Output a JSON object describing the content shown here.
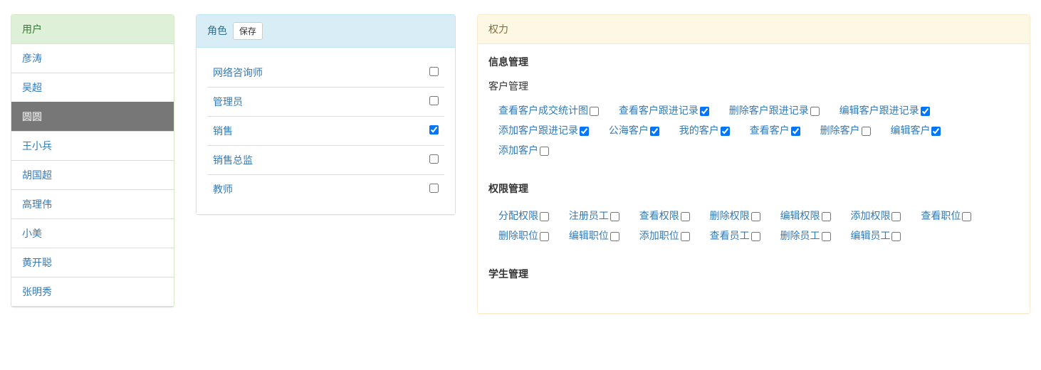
{
  "users": {
    "header": "用户",
    "items": [
      {
        "name": "彦涛",
        "active": false
      },
      {
        "name": "吴超",
        "active": false
      },
      {
        "name": "圆圆",
        "active": true
      },
      {
        "name": "王小兵",
        "active": false
      },
      {
        "name": "胡国超",
        "active": false
      },
      {
        "name": "高理伟",
        "active": false
      },
      {
        "name": "小美",
        "active": false
      },
      {
        "name": "黄开聪",
        "active": false
      },
      {
        "name": "张明秀",
        "active": false
      }
    ]
  },
  "roles": {
    "header": "角色",
    "save_label": "保存",
    "items": [
      {
        "name": "网络咨询师",
        "checked": false
      },
      {
        "name": "管理员",
        "checked": false
      },
      {
        "name": "销售",
        "checked": true
      },
      {
        "name": "销售总监",
        "checked": false
      },
      {
        "name": "教师",
        "checked": false
      }
    ]
  },
  "perms": {
    "header": "权力",
    "sections": [
      {
        "title": "信息管理",
        "groups": [
          {
            "subtitle": "客户管理",
            "items": [
              {
                "label": "查看客户成交统计图",
                "checked": false
              },
              {
                "label": "查看客户跟进记录",
                "checked": true
              },
              {
                "label": "删除客户跟进记录",
                "checked": false
              },
              {
                "label": "编辑客户跟进记录",
                "checked": true
              },
              {
                "label": "添加客户跟进记录",
                "checked": true
              },
              {
                "label": "公海客户",
                "checked": true
              },
              {
                "label": "我的客户",
                "checked": true
              },
              {
                "label": "查看客户",
                "checked": true
              },
              {
                "label": "删除客户",
                "checked": false
              },
              {
                "label": "编辑客户",
                "checked": true
              },
              {
                "label": "添加客户",
                "checked": false
              }
            ]
          }
        ]
      },
      {
        "title": "权限管理",
        "groups": [
          {
            "subtitle": "",
            "items": [
              {
                "label": "分配权限",
                "checked": false
              },
              {
                "label": "注册员工",
                "checked": false
              },
              {
                "label": "查看权限",
                "checked": false
              },
              {
                "label": "删除权限",
                "checked": false
              },
              {
                "label": "编辑权限",
                "checked": false
              },
              {
                "label": "添加权限",
                "checked": false
              },
              {
                "label": "查看职位",
                "checked": false
              },
              {
                "label": "删除职位",
                "checked": false
              },
              {
                "label": "编辑职位",
                "checked": false
              },
              {
                "label": "添加职位",
                "checked": false
              },
              {
                "label": "查看员工",
                "checked": false
              },
              {
                "label": "删除员工",
                "checked": false
              },
              {
                "label": "编辑员工",
                "checked": false
              }
            ]
          }
        ]
      },
      {
        "title": "学生管理",
        "groups": []
      }
    ]
  }
}
